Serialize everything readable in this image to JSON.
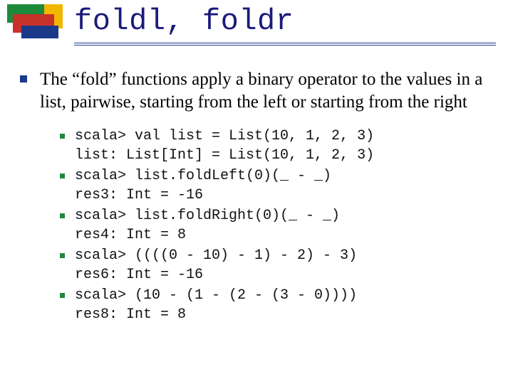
{
  "title": "foldl, foldr",
  "para": "The “fold” functions apply a binary operator to the values in a list, pairwise, starting from the left or starting from the right",
  "items": [
    {
      "l1": "scala> val list = List(10, 1, 2, 3)",
      "l2": "list: List[Int] = List(10, 1, 2, 3)"
    },
    {
      "l1": "scala> list.foldLeft(0)(_ - _)",
      "l2": "res3: Int = -16"
    },
    {
      "l1": "scala> list.foldRight(0)(_ - _)",
      "l2": "res4: Int = 8"
    },
    {
      "l1": "scala> ((((0 - 10) - 1) - 2) - 3)",
      "l2": "res6: Int = -16"
    },
    {
      "l1": "scala> (10 - (1 - (2 - (3 - 0))))",
      "l2": "res8: Int = 8"
    }
  ]
}
